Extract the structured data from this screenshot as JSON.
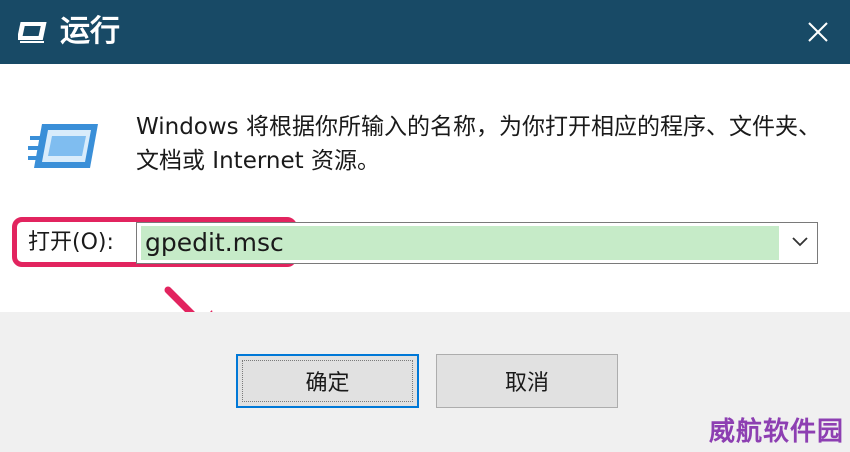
{
  "window": {
    "title": "运行",
    "close_icon": "close-icon"
  },
  "description": "Windows 将根据你所输入的名称，为你打开相应的程序、文件夹、文档或 Internet 资源。",
  "open_field": {
    "label": "打开(O):",
    "value": "gpedit.msc"
  },
  "buttons": {
    "ok": "确定",
    "cancel": "取消"
  },
  "watermark": "威航软件园",
  "colors": {
    "titlebar": "#184a66",
    "highlight_border": "#e2245f",
    "selection_fill": "#c6ebc8",
    "arrow": "#e2245f",
    "watermark": "#8d3fb2",
    "default_button_border": "#0078d7"
  }
}
